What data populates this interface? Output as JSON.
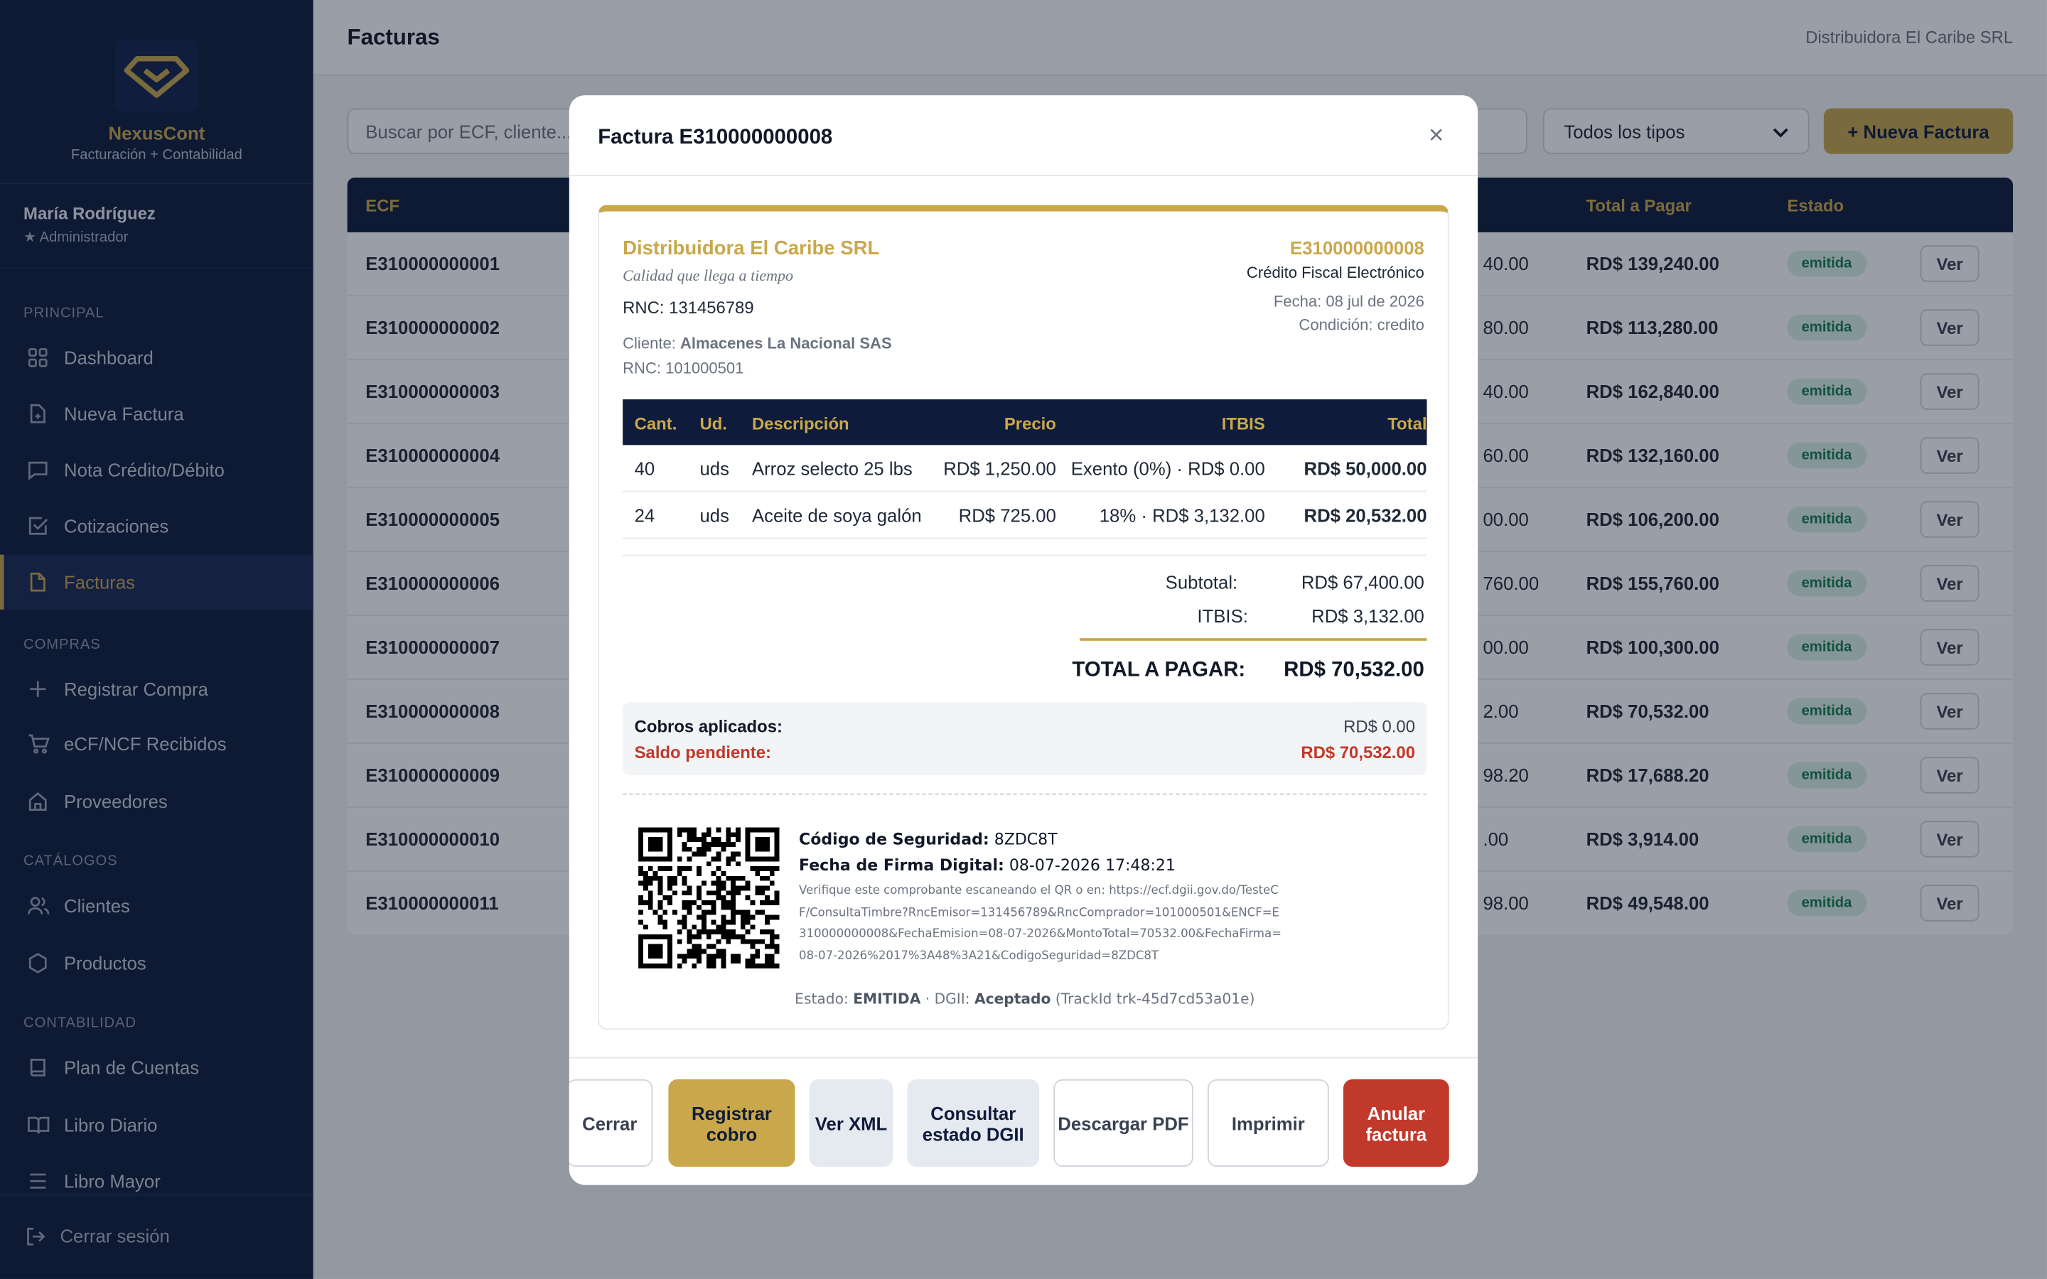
{
  "brand": {
    "name": "NexusCont",
    "tagline": "Facturación + Contabilidad"
  },
  "user": {
    "name": "María Rodríguez",
    "role": "★ Administrador"
  },
  "sidebar": {
    "sections": [
      "PRINCIPAL",
      "COMPRAS",
      "CATÁLOGOS",
      "CONTABILIDAD"
    ],
    "items": [
      {
        "label": "Dashboard",
        "icon": "grid-icon"
      },
      {
        "label": "Nueva Factura",
        "icon": "document-plus-icon"
      },
      {
        "label": "Nota Crédito/Débito",
        "icon": "message-icon"
      },
      {
        "label": "Cotizaciones",
        "icon": "check-square-icon"
      },
      {
        "label": "Facturas",
        "icon": "document-icon",
        "active": true
      },
      {
        "label": "Registrar Compra",
        "icon": "plus-icon"
      },
      {
        "label": "eCF/NCF Recibidos",
        "icon": "cart-icon"
      },
      {
        "label": "Proveedores",
        "icon": "home-icon"
      },
      {
        "label": "Clientes",
        "icon": "users-icon"
      },
      {
        "label": "Productos",
        "icon": "hexagon-icon"
      },
      {
        "label": "Plan de Cuentas",
        "icon": "book-icon"
      },
      {
        "label": "Libro Diario",
        "icon": "open-book-icon"
      },
      {
        "label": "Libro Mayor",
        "icon": "list-icon"
      }
    ],
    "logout": "Cerrar sesión"
  },
  "header": {
    "title": "Facturas",
    "company": "Distribuidora El Caribe SRL"
  },
  "toolbar": {
    "search_placeholder": "Buscar por ECF, cliente...",
    "filter_value": "Todos los tipos",
    "new_label": "+ Nueva Factura"
  },
  "table": {
    "headers": {
      "ecf": "ECF",
      "total": "Total a Pagar",
      "status": "Estado"
    },
    "rows": [
      {
        "ecf": "E310000000001",
        "partial": "40.00",
        "total": "RD$ 139,240.00",
        "status": "emitida",
        "action": "Ver"
      },
      {
        "ecf": "E310000000002",
        "partial": "80.00",
        "total": "RD$ 113,280.00",
        "status": "emitida",
        "action": "Ver"
      },
      {
        "ecf": "E310000000003",
        "partial": "40.00",
        "total": "RD$ 162,840.00",
        "status": "emitida",
        "action": "Ver"
      },
      {
        "ecf": "E310000000004",
        "partial": "60.00",
        "total": "RD$ 132,160.00",
        "status": "emitida",
        "action": "Ver"
      },
      {
        "ecf": "E310000000005",
        "partial": "00.00",
        "total": "RD$ 106,200.00",
        "status": "emitida",
        "action": "Ver"
      },
      {
        "ecf": "E310000000006",
        "partial": "760.00",
        "total": "RD$ 155,760.00",
        "status": "emitida",
        "action": "Ver"
      },
      {
        "ecf": "E310000000007",
        "partial": "00.00",
        "total": "RD$ 100,300.00",
        "status": "emitida",
        "action": "Ver"
      },
      {
        "ecf": "E310000000008",
        "partial": "2.00",
        "total": "RD$ 70,532.00",
        "status": "emitida",
        "action": "Ver"
      },
      {
        "ecf": "E310000000009",
        "partial": "98.20",
        "total": "RD$ 17,688.20",
        "status": "emitida",
        "action": "Ver"
      },
      {
        "ecf": "E310000000010",
        "partial": ".00",
        "total": "RD$ 3,914.00",
        "status": "emitida",
        "action": "Ver"
      },
      {
        "ecf": "E310000000011",
        "partial": "98.00",
        "total": "RD$ 49,548.00",
        "status": "emitida",
        "action": "Ver"
      }
    ]
  },
  "modal": {
    "title": "Factura E310000000008",
    "close": "×",
    "invoice": {
      "company": "Distribuidora El Caribe SRL",
      "slogan": "Calidad que llega a tiempo",
      "rnc": "RNC: 131456789",
      "client_label": "Cliente: ",
      "client_name": "Almacenes La Nacional SAS",
      "client_rnc": "RNC: 101000501",
      "ecf": "E310000000008",
      "type": "Crédito Fiscal Electrónico",
      "date": "Fecha: 08 jul de 2026",
      "condition": "Condición: credito",
      "columns": {
        "qty": "Cant.",
        "unit": "Ud.",
        "desc": "Descripción",
        "price": "Precio",
        "itbis": "ITBIS",
        "total": "Total"
      },
      "items": [
        {
          "qty": "40",
          "unit": "uds",
          "desc": "Arroz selecto 25 lbs",
          "price": "RD$ 1,250.00",
          "itbis": "Exento (0%) · RD$ 0.00",
          "total": "RD$ 50,000.00"
        },
        {
          "qty": "24",
          "unit": "uds",
          "desc": "Aceite de soya galón",
          "price": "RD$ 725.00",
          "itbis": "18% · RD$ 3,132.00",
          "total": "RD$ 20,532.00"
        }
      ],
      "subtotal_label": "Subtotal:",
      "subtotal": "RD$ 67,400.00",
      "itbis_label": "ITBIS:",
      "itbis": "RD$ 3,132.00",
      "total_label": "TOTAL A PAGAR:",
      "total": "RD$ 70,532.00",
      "paid_label": "Cobros aplicados:",
      "paid": "RD$ 0.00",
      "pending_label": "Saldo pendiente:",
      "pending": "RD$ 70,532.00",
      "security_label": "Código de Seguridad:",
      "security": "8ZDC8T",
      "sign_label": "Fecha de Firma Digital:",
      "sign_date": "08-07-2026 17:48:21",
      "verify": "Verifique este comprobante escaneando el QR o en: https://ecf.dgii.gov.do/TesteCF/ConsultaTimbre?RncEmisor=131456789&RncComprador=101000501&ENCF=E310000000008&FechaEmision=08-07-2026&MontoTotal=70532.00&FechaFirma=08-07-2026%2017%3A48%3A21&CodigoSeguridad=8ZDC8T",
      "status_prefix": "Estado: ",
      "status": "EMITIDA",
      "dgii_prefix": " · DGII: ",
      "dgii": "Aceptado",
      "track": " (TrackId trk-45d7cd53a01e)"
    },
    "buttons": {
      "close": "Cerrar",
      "register_payment": "Registrar cobro",
      "view_xml": "Ver XML",
      "check_dgii": "Consultar estado DGII",
      "download_pdf": "Descargar PDF",
      "print": "Imprimir",
      "void": "Anular factura"
    }
  },
  "colors": {
    "navy": "#0f1b3a",
    "gold": "#c9a84c",
    "danger": "#c0392b",
    "success_bg": "#d9f2e6"
  }
}
